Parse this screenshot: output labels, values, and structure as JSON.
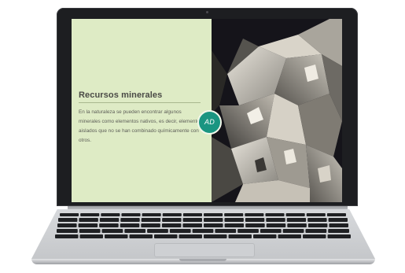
{
  "slide": {
    "title": "Recursos minerales",
    "body": "En la naturaleza se pueden encontrar algunos minerales como elementos nativos, es decir, elementos aislados que no se han combinado químicamente con otros.",
    "badge": "AD"
  },
  "image": {
    "subject": "mineral-crystals-photo"
  },
  "colors": {
    "panel_background": "#deebc5",
    "badge": "#1a9581",
    "title": "#4a4a46",
    "laptop_bezel": "#1d1e21"
  }
}
